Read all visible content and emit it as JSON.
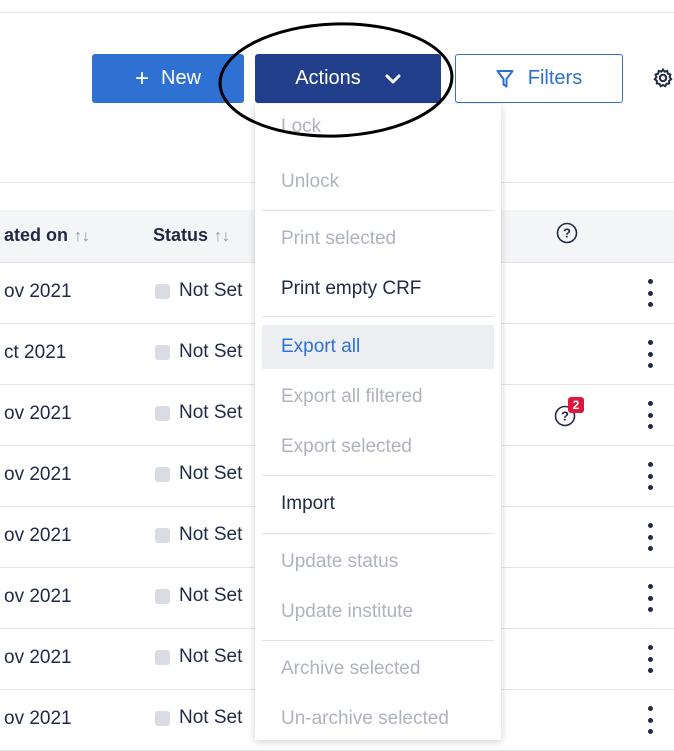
{
  "toolbar": {
    "new_label": "New",
    "actions_label": "Actions",
    "filters_label": "Filters"
  },
  "table": {
    "columns": {
      "created_on": "ated on",
      "status": "Status"
    },
    "rows": [
      {
        "date": "ov 2021",
        "status": "Not Set"
      },
      {
        "date": "ct 2021",
        "status": "Not Set"
      },
      {
        "date": "ov 2021",
        "status": "Not Set",
        "query_count": "2"
      },
      {
        "date": "ov 2021",
        "status": "Not Set"
      },
      {
        "date": "ov 2021",
        "status": "Not Set"
      },
      {
        "date": "ov 2021",
        "status": "Not Set"
      },
      {
        "date": "ov 2021",
        "status": "Not Set"
      },
      {
        "date": "ov 2021",
        "status": "Not Set"
      }
    ]
  },
  "actions_menu": {
    "items": [
      {
        "label": "Lock",
        "state": "disabled"
      },
      {
        "label": "Unlock",
        "state": "disabled"
      },
      {
        "label": "Print selected",
        "state": "disabled"
      },
      {
        "label": "Print empty CRF",
        "state": "enabled"
      },
      {
        "label": "Export all",
        "state": "hover"
      },
      {
        "label": "Export all filtered",
        "state": "disabled"
      },
      {
        "label": "Export selected",
        "state": "disabled"
      },
      {
        "label": "Import",
        "state": "enabled"
      },
      {
        "label": "Update status",
        "state": "disabled"
      },
      {
        "label": "Update institute",
        "state": "disabled"
      },
      {
        "label": "Archive selected",
        "state": "disabled"
      },
      {
        "label": "Un-archive selected",
        "state": "disabled"
      }
    ]
  },
  "colors": {
    "primary": "#2f70d3",
    "actions_bg": "#223f8c",
    "disabled_text": "#aeb3bd",
    "badge": "#e0173c"
  },
  "icons": {
    "new": "plus-icon",
    "actions": "chevron-down-icon",
    "filters": "funnel-icon",
    "settings": "gear-icon",
    "help": "question-circle-icon",
    "row_menu": "kebab-icon"
  }
}
